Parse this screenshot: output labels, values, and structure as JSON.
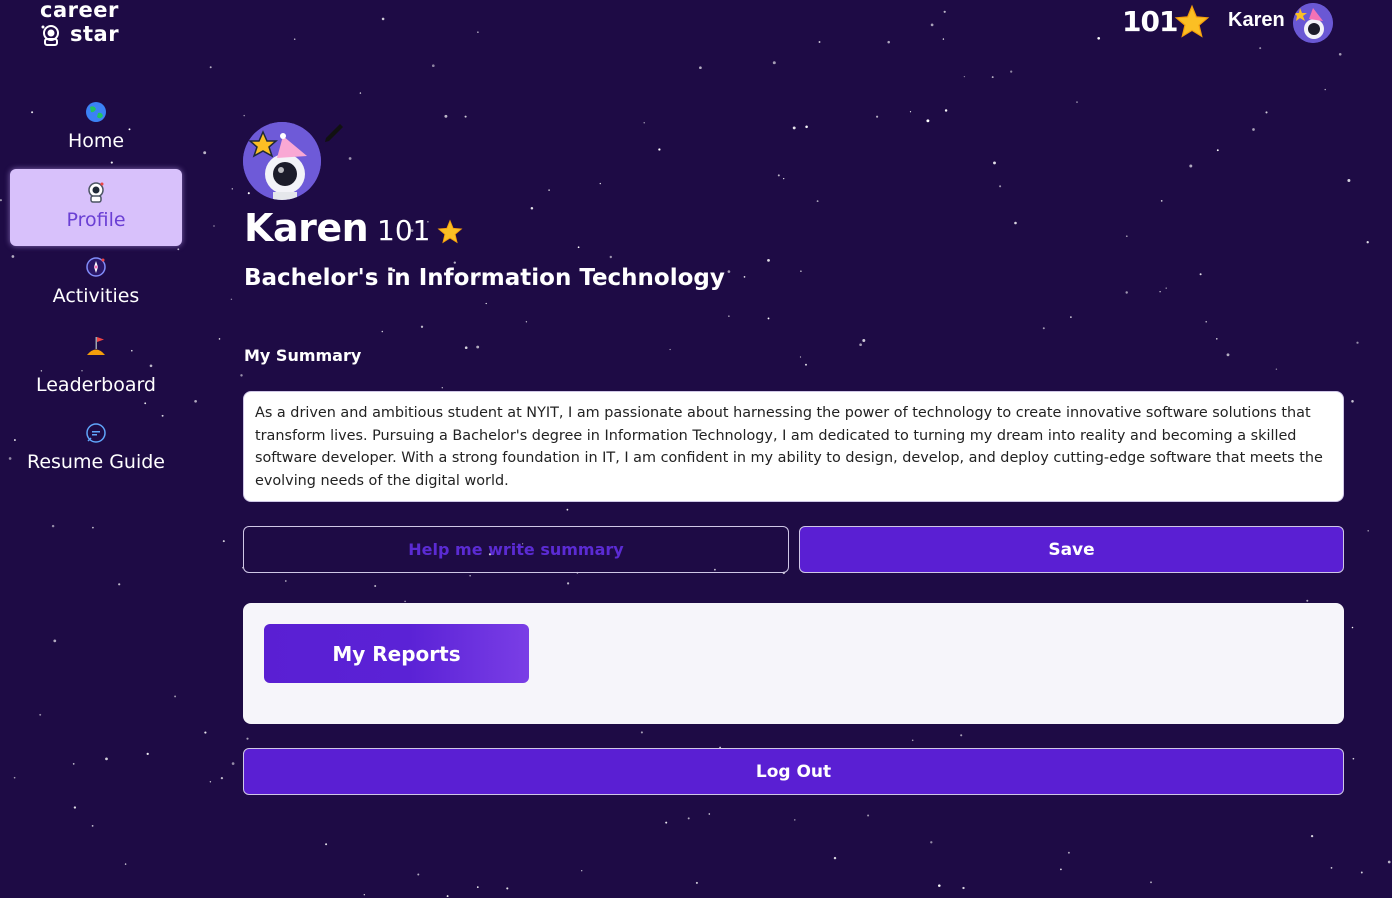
{
  "logo": {
    "line1": "career",
    "line2": "star"
  },
  "topbar": {
    "points": "101",
    "user_name": "Karen"
  },
  "sidebar": {
    "items": [
      {
        "label": "Home"
      },
      {
        "label": "Profile"
      },
      {
        "label": "Activities"
      },
      {
        "label": "Leaderboard"
      },
      {
        "label": "Resume Guide"
      }
    ],
    "active_index": 1
  },
  "profile": {
    "name": "Karen",
    "points": "101",
    "degree": "Bachelor's in Information Technology"
  },
  "summary": {
    "label": "My Summary",
    "text": "As a driven and ambitious student at NYIT, I am passionate about harnessing the power of technology to create innovative software solutions that transform lives. Pursuing a Bachelor's degree in Information Technology, I am dedicated to turning my dream into reality and becoming a skilled software developer. With a strong foundation in IT, I am confident in my ability to design, develop, and deploy cutting-edge software that meets the evolving needs of the digital world."
  },
  "buttons": {
    "help_label": "Help me write summary",
    "save_label": "Save",
    "reports_label": "My Reports",
    "logout_label": "Log Out"
  },
  "colors": {
    "background": "#1e0b45",
    "primary": "#5a1fd3",
    "active_nav": "#d8c1fb",
    "panel": "#f6f5fa"
  },
  "icons": {
    "home": "globe-icon",
    "profile": "astronaut-icon",
    "activities": "compass-icon",
    "leaderboard": "flag-hill-icon",
    "resume_guide": "chat-bubble-icon",
    "points": "star-icon",
    "edit": "pencil-icon"
  }
}
